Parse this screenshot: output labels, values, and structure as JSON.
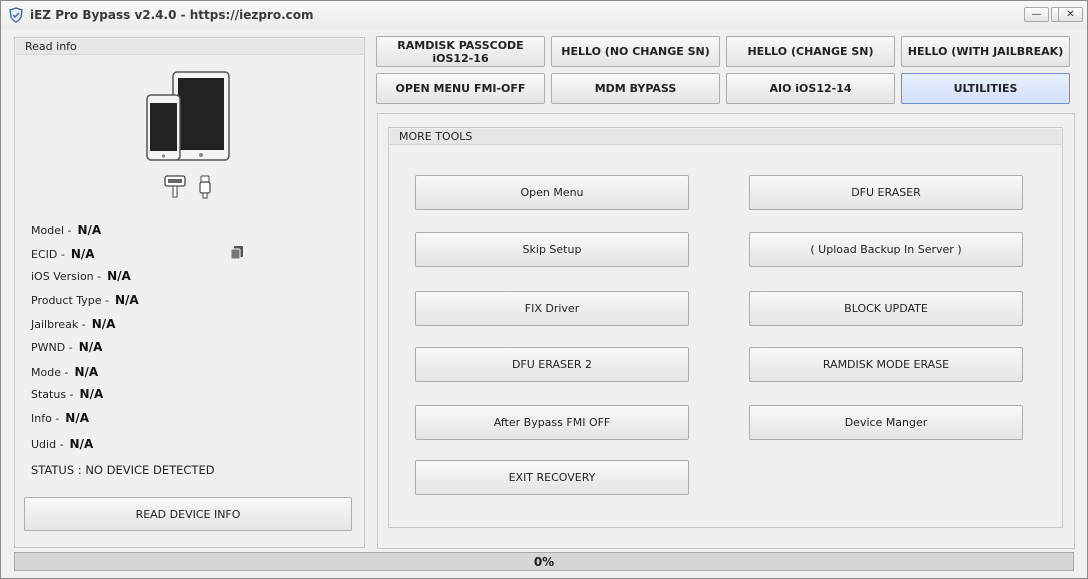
{
  "window": {
    "title": "iEZ Pro Bypass v2.4.0 - https://iezpro.com",
    "minimize": "—",
    "maximize": "□",
    "close": "✕"
  },
  "left_panel": {
    "header": "Read info",
    "fields": [
      {
        "label": "Model -",
        "value": "N/A"
      },
      {
        "label": "ECID -",
        "value": "N/A"
      },
      {
        "label": "iOS Version -",
        "value": "N/A"
      },
      {
        "label": "Product Type -",
        "value": "N/A"
      },
      {
        "label": "Jailbreak -",
        "value": "N/A"
      },
      {
        "label": "PWND -",
        "value": "N/A"
      },
      {
        "label": "Mode -",
        "value": "N/A"
      },
      {
        "label": "Status -",
        "value": "N/A"
      },
      {
        "label": "Info -",
        "value": "N/A"
      },
      {
        "label": "Udid -",
        "value": "N/A"
      }
    ],
    "status_text": "STATUS : NO DEVICE DETECTED",
    "read_button": "READ DEVICE INFO"
  },
  "top_buttons": [
    "RAMDISK PASSCODE iOS12-16",
    "HELLO (NO CHANGE SN)",
    "HELLO (CHANGE SN)",
    "HELLO (WITH JAILBREAK)",
    "OPEN MENU FMI-OFF",
    "MDM BYPASS",
    "AIO iOS12-14",
    "ULTILITIES"
  ],
  "more_tools": {
    "header": "MORE TOOLS",
    "left_buttons": [
      "Open Menu",
      "Skip Setup",
      "FIX Driver",
      "DFU ERASER 2",
      "After Bypass FMI OFF",
      "EXIT RECOVERY"
    ],
    "right_buttons": [
      "DFU ERASER",
      "( Upload Backup In Server )",
      "BLOCK UPDATE",
      "RAMDISK MODE ERASE",
      "Device Manger"
    ]
  },
  "progress": {
    "text": "0%",
    "value": 0
  },
  "colors": {
    "active_tab": "#d3e0fa",
    "progress_fill": "#5aa05a"
  }
}
